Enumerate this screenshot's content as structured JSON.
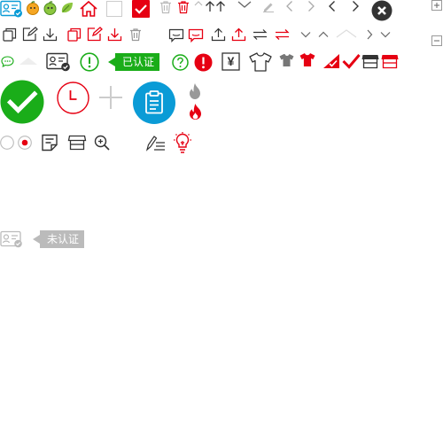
{
  "colors": {
    "red": "#e60012",
    "green": "#1aad19",
    "blue": "#0a9bd6",
    "gray": "#999999",
    "light_gray": "#cccccc",
    "dark": "#333333",
    "tag_gray": "#bbbbbb"
  },
  "badges": {
    "verified": "已认证",
    "unverified": "未认证",
    "currency": "¥"
  },
  "icons": [
    "id-card-verified-icon",
    "orange-emoji-icon",
    "green-emoji-icon",
    "leaf-icon",
    "home-icon",
    "checkbox-empty-icon",
    "checkbox-checked-icon",
    "trash-icon",
    "chevron-up-icon",
    "arrow-up-icon",
    "chevron-down-icon",
    "pencil-icon",
    "chevron-left-icon",
    "chevron-right-icon",
    "close-circle-icon",
    "expand-plus-icon",
    "collapse-minus-icon",
    "copy-icon",
    "edit-icon",
    "download-icon",
    "comment-icon",
    "upload-icon",
    "swap-icon",
    "chat-bubble-icon",
    "id-card-icon",
    "exclamation-circle-icon",
    "help-circle-icon",
    "yuan-icon",
    "t-shirt-icon",
    "check-corner-icon",
    "checkmark-icon",
    "store-icon",
    "check-circle-icon",
    "clock-icon",
    "plus-icon",
    "clipboard-icon",
    "fire-icon",
    "radio-icon",
    "radio-selected-icon",
    "note-icon",
    "zoom-in-icon",
    "pen-list-icon",
    "lightbulb-icon"
  ]
}
